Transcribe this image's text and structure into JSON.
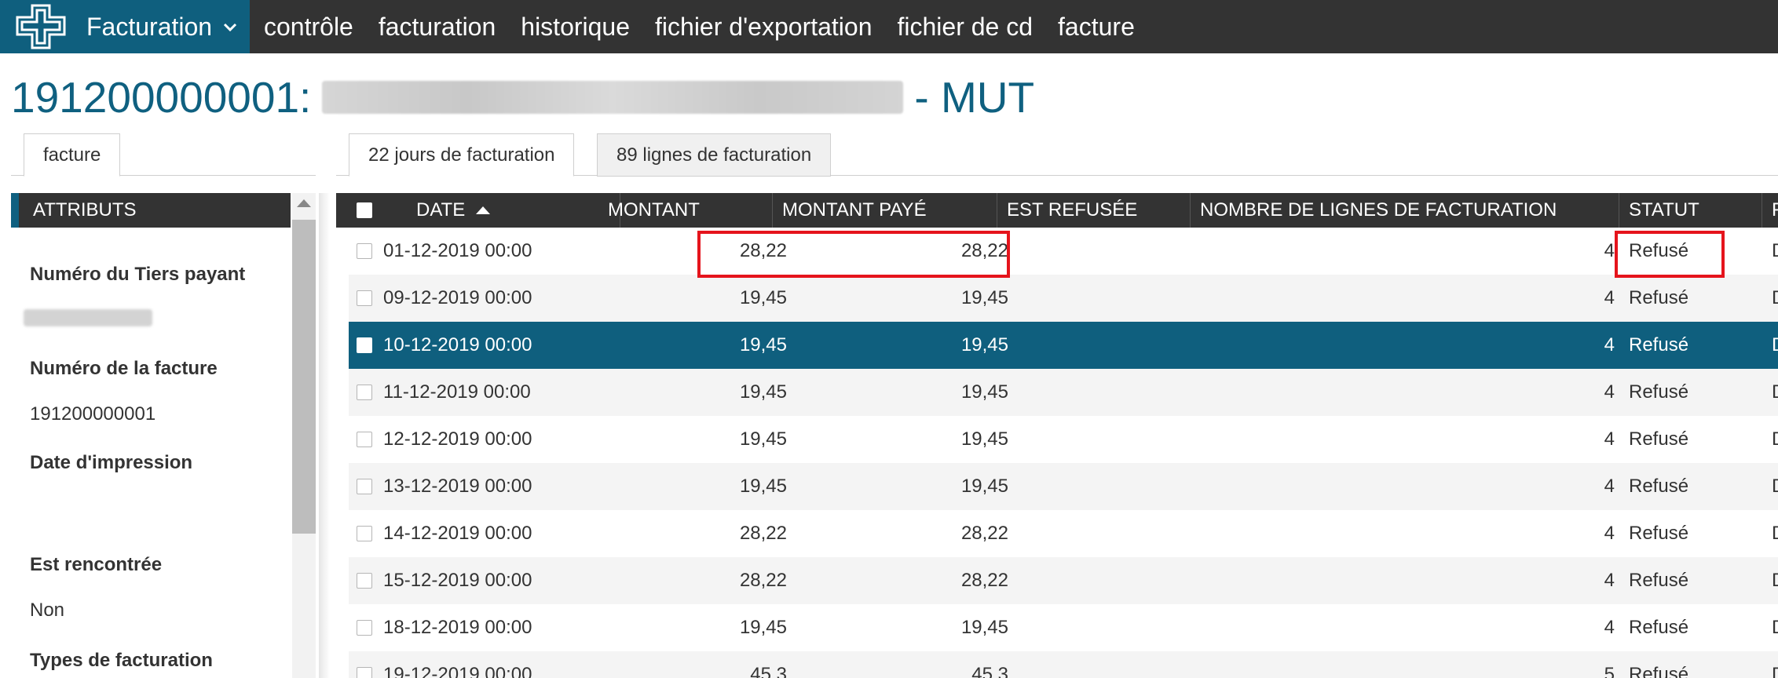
{
  "topnav": {
    "brand_title": "Facturation",
    "items": [
      "contrôle",
      "facturation",
      "historique",
      "fichier d'exportation",
      "fichier de cd",
      "facture"
    ]
  },
  "page": {
    "title_prefix": "191200000001:",
    "title_suffix": "- MUT"
  },
  "left": {
    "tab_label": "facture",
    "panel_header": "ATTRIBUTS",
    "attributes": [
      {
        "label": "Numéro du Tiers payant",
        "value": ""
      },
      {
        "label": "Numéro de la facture",
        "value": "191200000001"
      },
      {
        "label": "Date d'impression",
        "value": ""
      },
      {
        "label": "Est rencontrée",
        "value": "Non"
      },
      {
        "label": "Types de facturation",
        "value": ""
      }
    ]
  },
  "right": {
    "tabs": [
      "22 jours de facturation",
      "89 lignes de facturation"
    ]
  },
  "grid": {
    "columns": [
      "DATE",
      "MONTANT",
      "MONTANT PAYÉ",
      "EST REFUSÉE",
      "NOMBRE DE LIGNES DE FACTURATION",
      "STATUT",
      "F"
    ],
    "rows": [
      {
        "date": "01-12-2019 00:00",
        "montant": "28,22",
        "paye": "28,22",
        "refusee": "",
        "lignes": "4",
        "statut": "Refusé",
        "extra": "D"
      },
      {
        "date": "09-12-2019 00:00",
        "montant": "19,45",
        "paye": "19,45",
        "refusee": "",
        "lignes": "4",
        "statut": "Refusé",
        "extra": "D"
      },
      {
        "date": "10-12-2019 00:00",
        "montant": "19,45",
        "paye": "19,45",
        "refusee": "",
        "lignes": "4",
        "statut": "Refusé",
        "extra": "D"
      },
      {
        "date": "11-12-2019 00:00",
        "montant": "19,45",
        "paye": "19,45",
        "refusee": "",
        "lignes": "4",
        "statut": "Refusé",
        "extra": "D"
      },
      {
        "date": "12-12-2019 00:00",
        "montant": "19,45",
        "paye": "19,45",
        "refusee": "",
        "lignes": "4",
        "statut": "Refusé",
        "extra": "D"
      },
      {
        "date": "13-12-2019 00:00",
        "montant": "19,45",
        "paye": "19,45",
        "refusee": "",
        "lignes": "4",
        "statut": "Refusé",
        "extra": "D"
      },
      {
        "date": "14-12-2019 00:00",
        "montant": "28,22",
        "paye": "28,22",
        "refusee": "",
        "lignes": "4",
        "statut": "Refusé",
        "extra": "D"
      },
      {
        "date": "15-12-2019 00:00",
        "montant": "28,22",
        "paye": "28,22",
        "refusee": "",
        "lignes": "4",
        "statut": "Refusé",
        "extra": "D"
      },
      {
        "date": "18-12-2019 00:00",
        "montant": "19,45",
        "paye": "19,45",
        "refusee": "",
        "lignes": "4",
        "statut": "Refusé",
        "extra": "D"
      },
      {
        "date": "19-12-2019 00:00",
        "montant": "45,3",
        "paye": "45,3",
        "refusee": "",
        "lignes": "5",
        "statut": "Refusé",
        "extra": "D"
      }
    ],
    "selected_row": 2
  },
  "colors": {
    "nav_bg": "#333333",
    "brand_bg": "#0f5f7e",
    "title": "#0f6080",
    "selected_row": "#0f5f7e",
    "highlight": "#e5141c"
  }
}
